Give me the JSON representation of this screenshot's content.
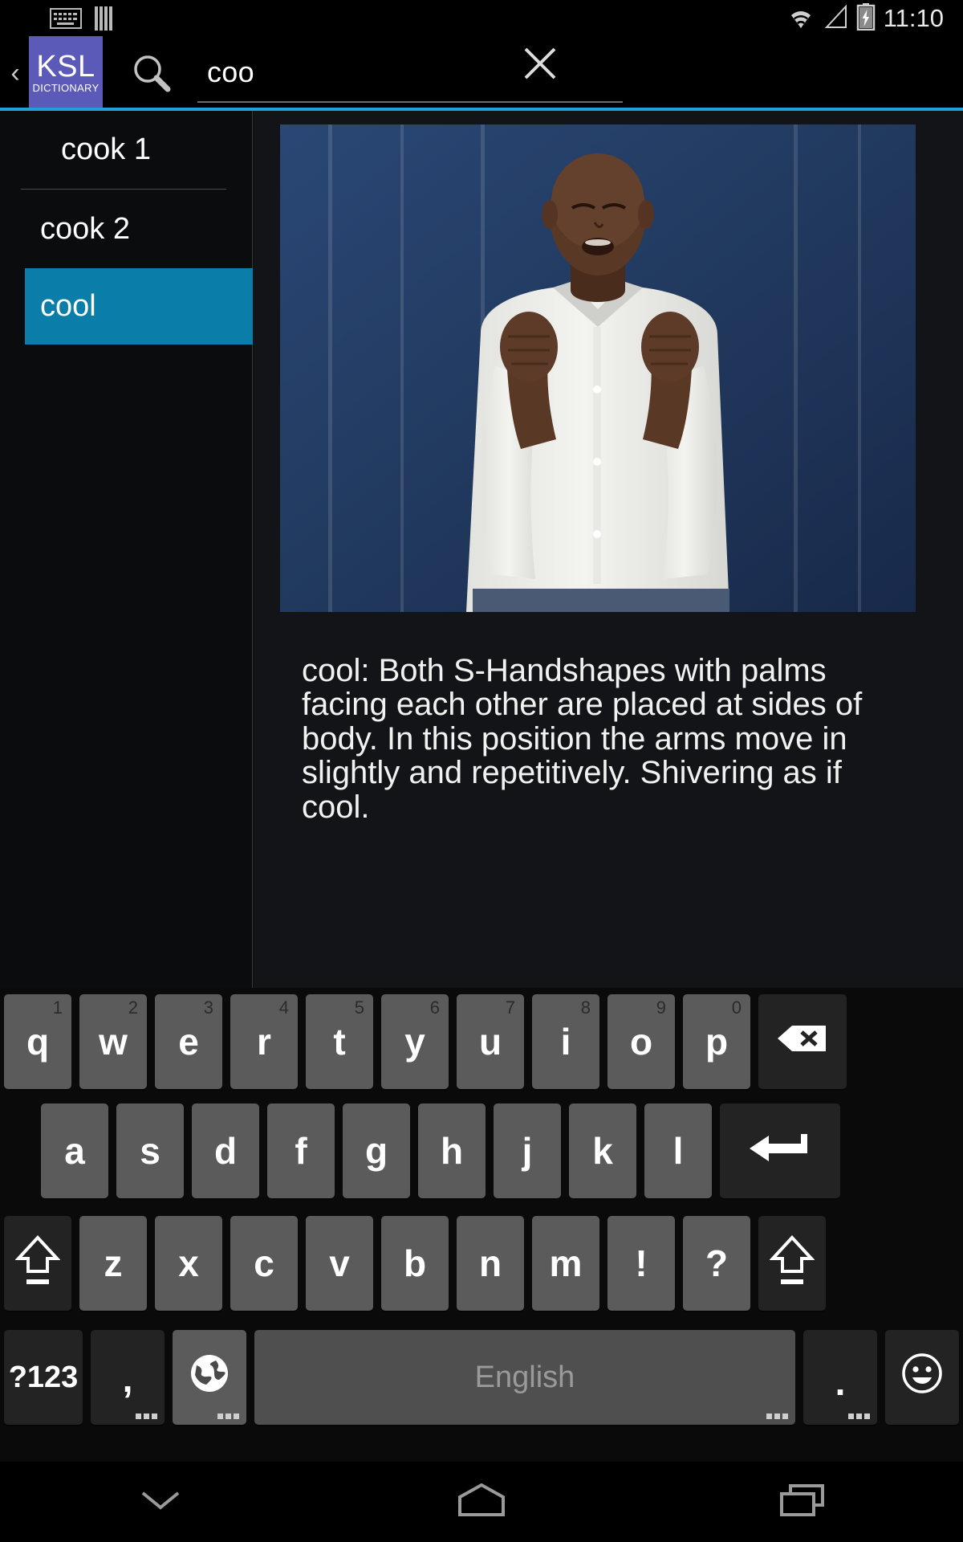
{
  "statusbar": {
    "time": "11:10",
    "icons": [
      "keyboard-icon",
      "signal-bars-icon",
      "wifi-icon",
      "cellular-icon",
      "battery-charging-icon"
    ]
  },
  "appbar": {
    "back_label": "‹",
    "logo_main": "KSL",
    "logo_sub": "DICTIONARY",
    "logo_color": "#5c5ab8",
    "accent_color": "#1fa0d8",
    "search": {
      "value": "coo",
      "placeholder": "Search",
      "search_icon": "search-icon",
      "clear_icon": "close-icon"
    }
  },
  "sidebar": {
    "items": [
      {
        "label": "cook 1",
        "selected": false
      },
      {
        "label": "cook 2",
        "selected": false
      },
      {
        "label": "cool",
        "selected": true
      }
    ],
    "selected_color": "#0a7ea8"
  },
  "detail": {
    "media_alt": "sign-language-video",
    "description": "cool: Both S-Handshapes with palms facing each other are placed at sides of body. In this position the arms move in slightly and repetitively. Shivering as if cool."
  },
  "keyboard": {
    "row1": [
      {
        "label": "q",
        "num": "1"
      },
      {
        "label": "w",
        "num": "2"
      },
      {
        "label": "e",
        "num": "3"
      },
      {
        "label": "r",
        "num": "4"
      },
      {
        "label": "t",
        "num": "5"
      },
      {
        "label": "y",
        "num": "6"
      },
      {
        "label": "u",
        "num": "7"
      },
      {
        "label": "i",
        "num": "8"
      },
      {
        "label": "o",
        "num": "9"
      },
      {
        "label": "p",
        "num": "0"
      }
    ],
    "backspace_icon": "backspace-icon",
    "row2": [
      {
        "label": "a"
      },
      {
        "label": "s"
      },
      {
        "label": "d"
      },
      {
        "label": "f"
      },
      {
        "label": "g"
      },
      {
        "label": "h"
      },
      {
        "label": "j"
      },
      {
        "label": "k"
      },
      {
        "label": "l"
      }
    ],
    "enter_icon": "enter-icon",
    "row3": [
      {
        "label": "z"
      },
      {
        "label": "x"
      },
      {
        "label": "c"
      },
      {
        "label": "v"
      },
      {
        "label": "b"
      },
      {
        "label": "n"
      },
      {
        "label": "m"
      },
      {
        "label": "!"
      },
      {
        "label": "?"
      }
    ],
    "shift_left_icon": "shift-icon",
    "shift_right_icon": "shift-icon",
    "row4": {
      "symbols_label": "?123",
      "comma_label": ",",
      "language_icon": "globe-icon",
      "space_label": "English",
      "period_label": ".",
      "emoji_icon": "emoji-icon"
    }
  },
  "navbar": {
    "back_icon": "hide-keyboard-chevron-icon",
    "home_icon": "home-icon",
    "recents_icon": "recents-icon"
  }
}
